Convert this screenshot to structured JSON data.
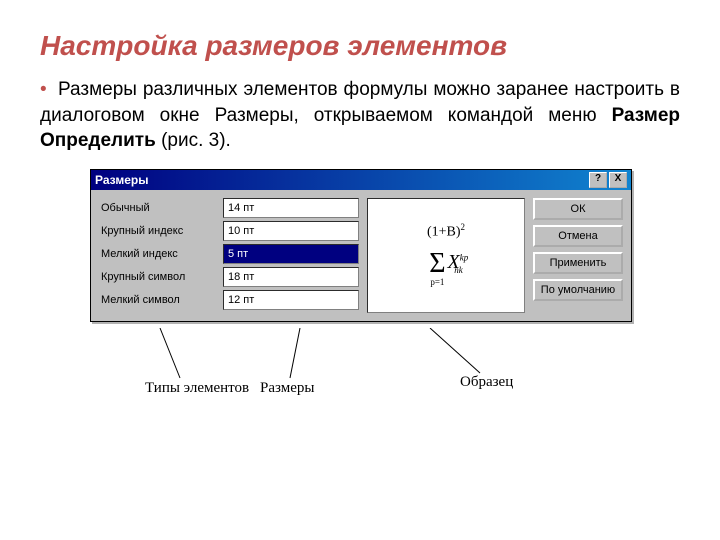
{
  "title": "Настройка размеров элементов",
  "bullet": {
    "prefix": "• ",
    "text_before": "Размеры различных элементов формулы можно заранее настроить в диалоговом окне Размеры, открываемом командой меню ",
    "bold1": "Размер",
    "arrow_spacer": " ",
    "bold2": "Определить",
    "text_after": " (рис. 3)."
  },
  "dialog": {
    "title": "Размеры",
    "help": "?",
    "close": "X",
    "fields": [
      {
        "label": "Обычный",
        "value": "14 пт",
        "selected": false
      },
      {
        "label": "Крупный индекс",
        "value": "10 пт",
        "selected": false
      },
      {
        "label": "Мелкий индекс",
        "value": "5 пт",
        "selected": true
      },
      {
        "label": "Крупный символ",
        "value": "18 пт",
        "selected": false
      },
      {
        "label": "Мелкий символ",
        "value": "12 пт",
        "selected": false
      }
    ],
    "buttons": {
      "ok": "ОК",
      "cancel": "Отмена",
      "apply": "Применить",
      "default": "По умолчанию"
    },
    "preview": {
      "top": "(1+B)",
      "top_sup": "2",
      "sigma": "Σ",
      "lower": "p=1",
      "term": "X",
      "term_sup": "kp",
      "term_sub": "nk"
    }
  },
  "callouts": {
    "types": "Типы элементов",
    "sizes": "Размеры",
    "sample": "Образец"
  }
}
